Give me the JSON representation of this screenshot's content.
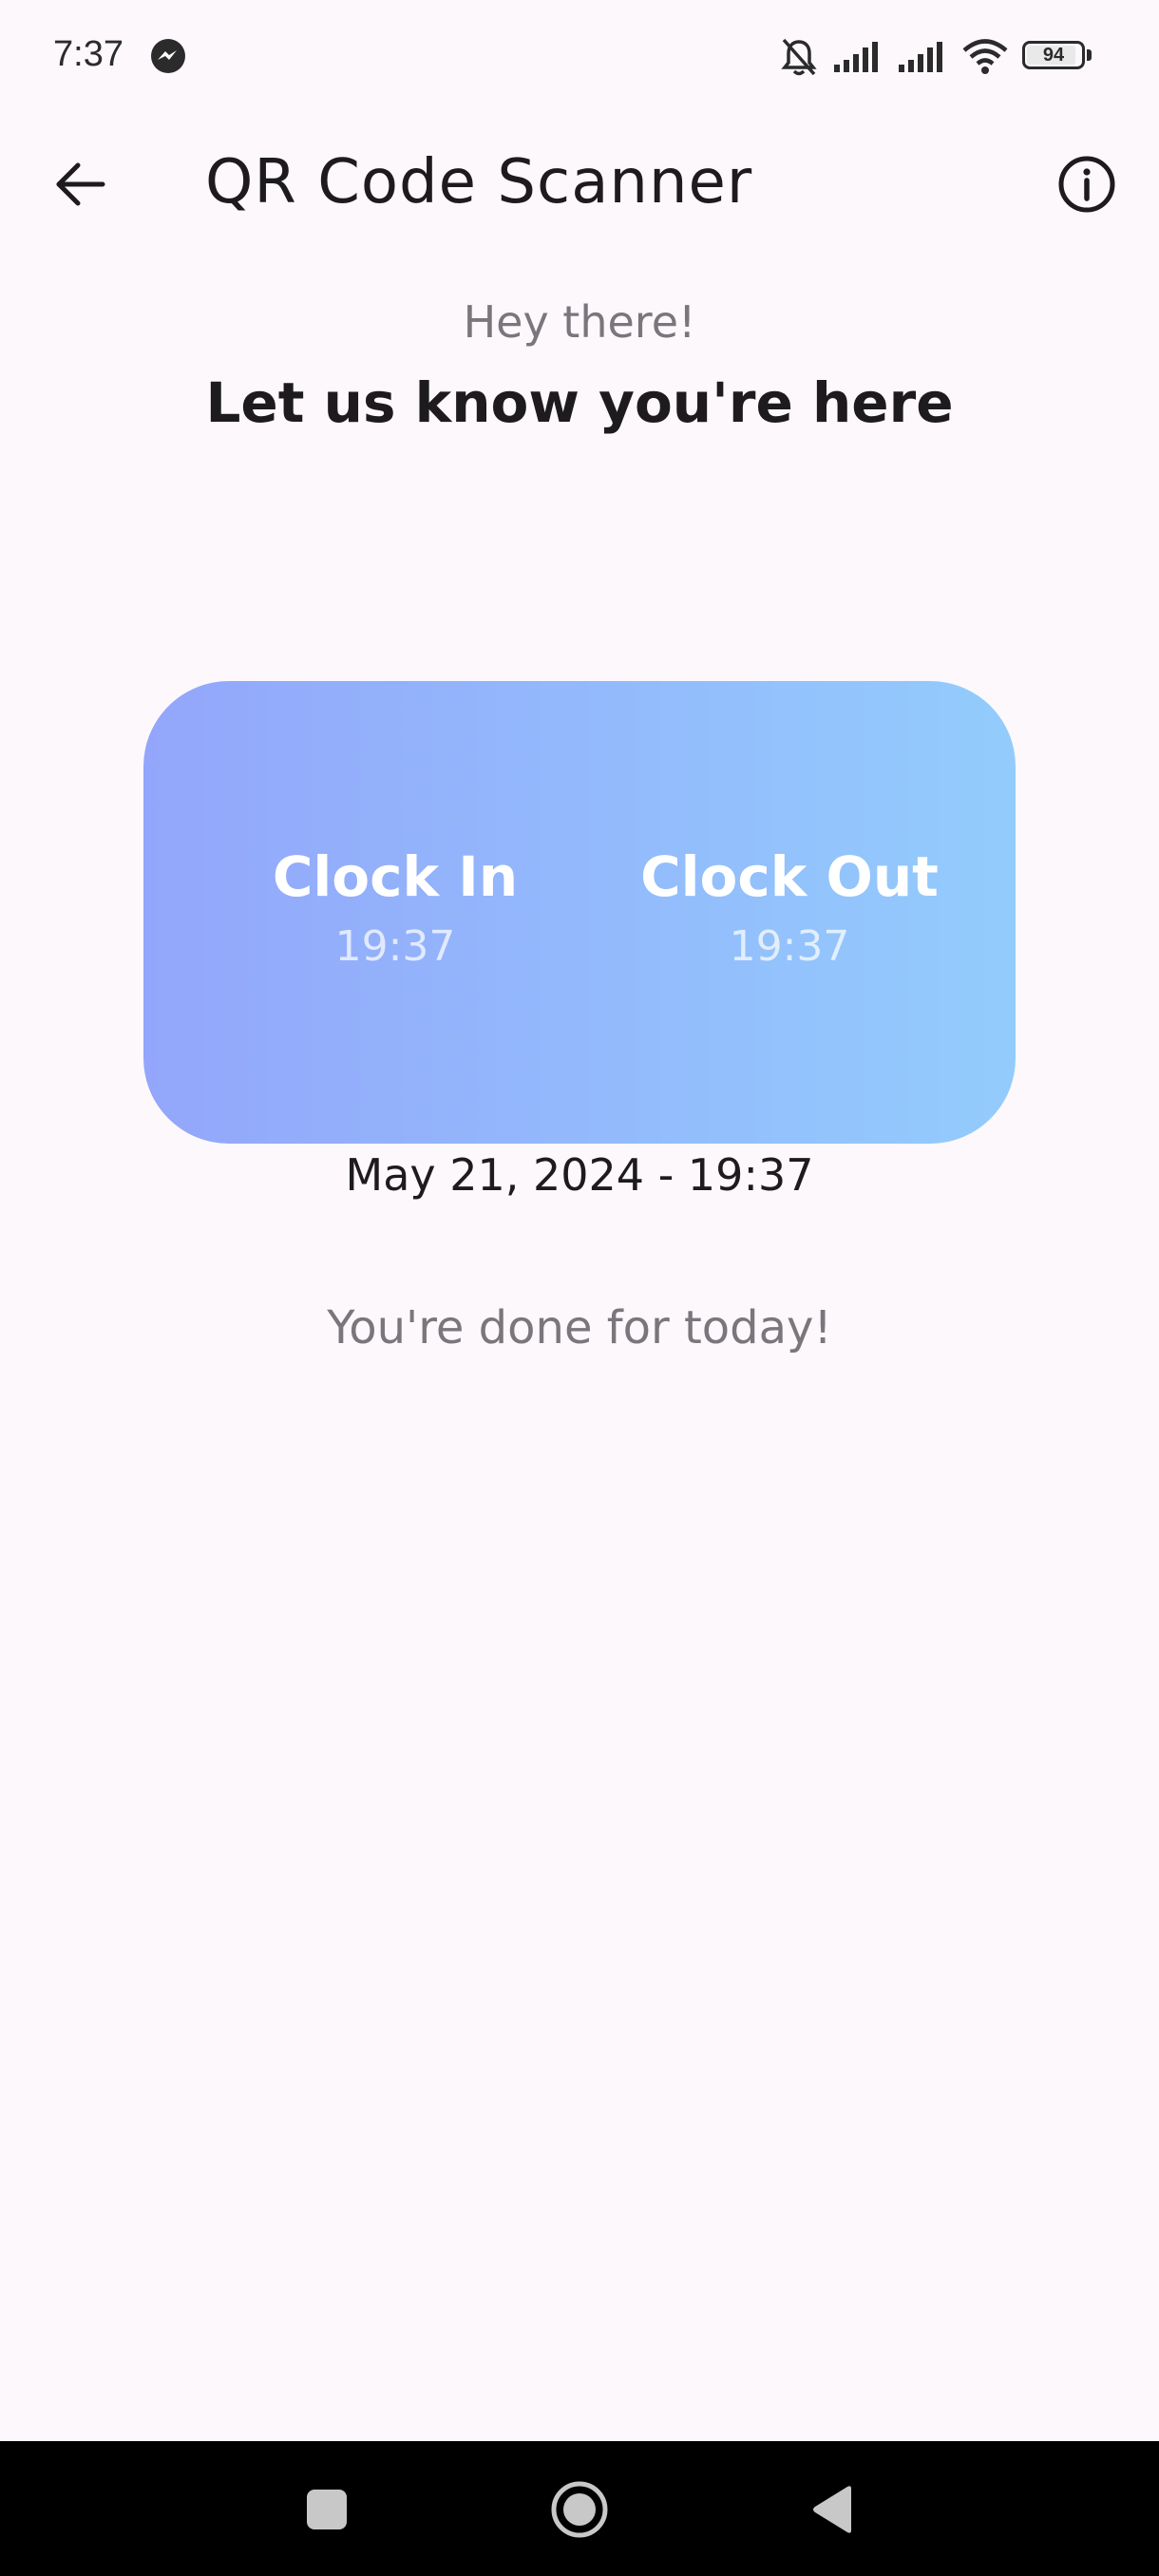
{
  "status_bar": {
    "time": "7:37",
    "battery_level": "94",
    "icons": [
      "messenger-icon",
      "bell-muted-icon",
      "signal-icon",
      "signal-icon",
      "wifi-icon",
      "battery-icon"
    ]
  },
  "app_bar": {
    "title": "QR Code Scanner",
    "back_icon": "arrow-left-icon",
    "info_icon": "info-icon"
  },
  "greeting": {
    "subtitle": "Hey there!",
    "headline": "Let us know you're here"
  },
  "clock_card": {
    "clock_in_label": "Clock In",
    "clock_in_time": "19:37",
    "clock_out_label": "Clock Out",
    "clock_out_time": "19:37",
    "gradient_start": "#93a6fb",
    "gradient_end": "#93ccfc"
  },
  "datetime": "May 21, 2024 - 19:37",
  "status_message": "You're done for today!",
  "nav_bar": {
    "buttons": [
      "recents-icon",
      "home-icon",
      "back-icon"
    ]
  }
}
